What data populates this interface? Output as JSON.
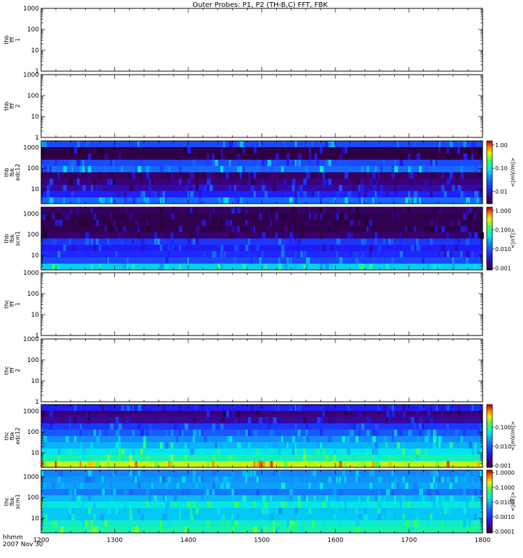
{
  "chart_data": {
    "type": "heatmap",
    "title": "Outer Probes: P1, P2 (TH-B,C) FFT, FBK",
    "x_ticks": [
      "1200",
      "1300",
      "1400",
      "1500",
      "1600",
      "1700",
      "1800"
    ],
    "xlim": [
      1200,
      1800
    ],
    "x_axis_label": "hhmm",
    "date_label": "2007 Nov 30",
    "y_scale": "log",
    "panels": [
      {
        "label_lines": [
          "thb",
          "fff",
          "1"
        ],
        "ylim": [
          1,
          1000
        ],
        "y_ticks": [
          "1",
          "10",
          "100",
          "1000"
        ],
        "has_data": false
      },
      {
        "label_lines": [
          "thb",
          "fff",
          "2"
        ],
        "ylim": [
          1,
          1000
        ],
        "y_ticks": [
          "1",
          "10",
          "100",
          "1000"
        ],
        "has_data": false
      },
      {
        "label_lines": [
          "thb",
          "fbk",
          "edc12"
        ],
        "ylim": [
          2,
          2048
        ],
        "y_ticks": [
          "10",
          "100",
          "1000"
        ],
        "has_data": true,
        "colorbar": {
          "label": "<|mV/m|>",
          "ticks": [
            "0.01",
            "0.10",
            "1.00"
          ],
          "range": [
            0.003,
            1.5
          ]
        },
        "bands": [
          {
            "name": "2048",
            "level": 0.02
          },
          {
            "name": "1024",
            "level": 0.0035
          },
          {
            "name": "512",
            "level": 0.0035
          },
          {
            "name": "256",
            "level": 0.02
          },
          {
            "name": "128",
            "level": 0.03
          },
          {
            "name": "64",
            "level": 0.004
          },
          {
            "name": "32",
            "level": 0.005
          },
          {
            "name": "16",
            "level": 0.007
          },
          {
            "name": "8",
            "level": 0.012
          },
          {
            "name": "4",
            "level": 0.03
          }
        ]
      },
      {
        "label_lines": [
          "thb",
          "fbk",
          "scm1"
        ],
        "ylim": [
          2,
          2048
        ],
        "y_ticks": [
          "10",
          "100",
          "1000"
        ],
        "has_data": true,
        "colorbar": {
          "label": "<|nT|>",
          "ticks": [
            "0.001",
            "0.010",
            "0.100",
            "1.000"
          ],
          "range": [
            0.0008,
            1.5
          ]
        },
        "bands": [
          {
            "name": "2048",
            "level": 0.0012
          },
          {
            "name": "1024",
            "level": 0.001
          },
          {
            "name": "512",
            "level": 0.001
          },
          {
            "name": "256",
            "level": 0.001
          },
          {
            "name": "128",
            "level": 0.0013
          },
          {
            "name": "64",
            "level": 0.006
          },
          {
            "name": "32",
            "level": 0.004
          },
          {
            "name": "16",
            "level": 0.005
          },
          {
            "name": "8",
            "level": 0.008
          },
          {
            "name": "4",
            "level": 0.04
          }
        ]
      },
      {
        "label_lines": [
          "thc",
          "fff",
          "1"
        ],
        "ylim": [
          1,
          1000
        ],
        "y_ticks": [
          "1",
          "10",
          "100",
          "1000"
        ],
        "has_data": false
      },
      {
        "label_lines": [
          "thc",
          "fff",
          "2"
        ],
        "ylim": [
          1,
          1000
        ],
        "y_ticks": [
          "1",
          "10",
          "100",
          "1000"
        ],
        "has_data": false
      },
      {
        "label_lines": [
          "thc",
          "fbk",
          "edc12"
        ],
        "ylim": [
          2,
          2048
        ],
        "y_ticks": [
          "10",
          "100",
          "1000"
        ],
        "has_data": true,
        "colorbar": {
          "label": "<|mV/m|>",
          "ticks": [
            "0.001",
            "0.010",
            "0.100"
          ],
          "range": [
            0.0008,
            1.5
          ]
        },
        "bands": [
          {
            "name": "2048",
            "level": 0.004
          },
          {
            "name": "1024",
            "level": 0.0015
          },
          {
            "name": "512",
            "level": 0.002
          },
          {
            "name": "256",
            "level": 0.006
          },
          {
            "name": "128",
            "level": 0.01
          },
          {
            "name": "64",
            "level": 0.02
          },
          {
            "name": "32",
            "level": 0.03
          },
          {
            "name": "16",
            "level": 0.05
          },
          {
            "name": "8",
            "level": 0.08
          },
          {
            "name": "4",
            "level": 0.3
          }
        ]
      },
      {
        "label_lines": [
          "thc",
          "fbk",
          "scm1"
        ],
        "ylim": [
          2,
          2048
        ],
        "y_ticks": [
          "10",
          "100",
          "1000"
        ],
        "has_data": true,
        "colorbar": {
          "label": "<|nT|>",
          "ticks": [
            "0.0001",
            "0.0010",
            "0.0100",
            "0.1000",
            "1.0000"
          ],
          "range": [
            8e-05,
            1.5
          ]
        },
        "bands": [
          {
            "name": "2048",
            "level": 0.005
          },
          {
            "name": "1024",
            "level": 0.006
          },
          {
            "name": "512",
            "level": 0.007
          },
          {
            "name": "256",
            "level": 0.004
          },
          {
            "name": "128",
            "level": 0.01
          },
          {
            "name": "64",
            "level": 0.02
          },
          {
            "name": "32",
            "level": 0.012
          },
          {
            "name": "16",
            "level": 0.012
          },
          {
            "name": "8",
            "level": 0.025
          },
          {
            "name": "4",
            "level": 0.035
          }
        ]
      }
    ]
  }
}
